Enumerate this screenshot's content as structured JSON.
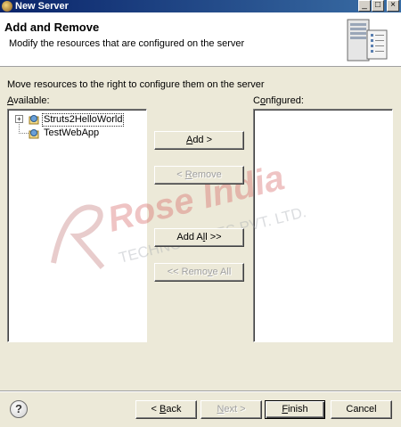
{
  "window": {
    "title": "New Server",
    "minimize": "_",
    "maximize": "□",
    "close": "×"
  },
  "header": {
    "title": "Add and Remove",
    "subtitle": "Modify the resources that are configured on the server"
  },
  "content": {
    "instruction": "Move resources to the right to configure them on the server",
    "available_label_mnemonic": "A",
    "available_label_rest": "vailable:",
    "configured_label_prefix": "C",
    "configured_label_mnemonic": "o",
    "configured_label_rest": "nfigured:"
  },
  "available": [
    {
      "label": "Struts2HelloWorld",
      "expandable": true,
      "expander": "+",
      "selected": true
    },
    {
      "label": "TestWebApp",
      "expandable": false,
      "selected": false
    }
  ],
  "configured": [],
  "buttons": {
    "add_mnemonic": "A",
    "add_rest": "dd >",
    "remove_prefix": "< ",
    "remove_mnemonic": "R",
    "remove_rest": "emove",
    "addall_prefix": "Add A",
    "addall_mnemonic": "l",
    "addall_rest": "l >>",
    "removeall_prefix": "<< Remo",
    "removeall_mnemonic": "v",
    "removeall_rest": "e All"
  },
  "footer": {
    "help": "?",
    "back_prefix": "< ",
    "back_mnemonic": "B",
    "back_rest": "ack",
    "next_mnemonic": "N",
    "next_rest": "ext >",
    "finish_mnemonic": "F",
    "finish_rest": "inish",
    "cancel": "Cancel"
  },
  "watermark": {
    "brand": "Rose India",
    "tagline": "TECHNOLOGIES PVT. LTD."
  },
  "icons": {
    "app": "eclipse-icon",
    "header": "server-icon",
    "project": "web-project-icon",
    "help": "help-icon"
  }
}
